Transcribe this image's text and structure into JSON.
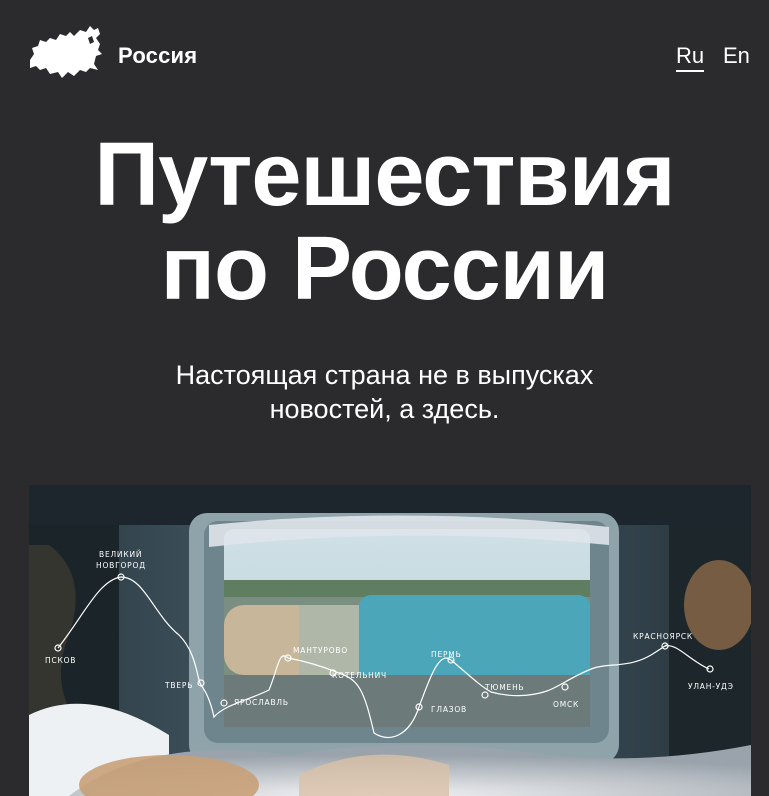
{
  "header": {
    "brand": "Россия",
    "languages": [
      {
        "label": "Ru",
        "active": true
      },
      {
        "label": "En",
        "active": false
      }
    ]
  },
  "hero": {
    "title_line1": "Путешествия",
    "title_line2": "по России",
    "subtitle_line1": "Настоящая страна не в выпусках",
    "subtitle_line2": "новостей, а здесь."
  },
  "route": {
    "cities": [
      {
        "name": "ПСКОВ"
      },
      {
        "name": "ВЕЛИКИЙ",
        "name2": "НОВГОРОД"
      },
      {
        "name": "ТВЕРЬ"
      },
      {
        "name": "ЯРОСЛАВЛЬ"
      },
      {
        "name": "МАНТУРОВО"
      },
      {
        "name": "КОТЕЛЬНИЧ"
      },
      {
        "name": "ГЛАЗОВ"
      },
      {
        "name": "ПЕРМЬ"
      },
      {
        "name": "ТЮМЕНЬ"
      },
      {
        "name": "ОМСК"
      },
      {
        "name": "КРАСНОЯРСК"
      },
      {
        "name": "УЛАН-УДЭ"
      }
    ]
  },
  "colors": {
    "background": "#2b2b2e",
    "text": "#ffffff"
  },
  "icons": {
    "logo": "russia-map-icon"
  }
}
